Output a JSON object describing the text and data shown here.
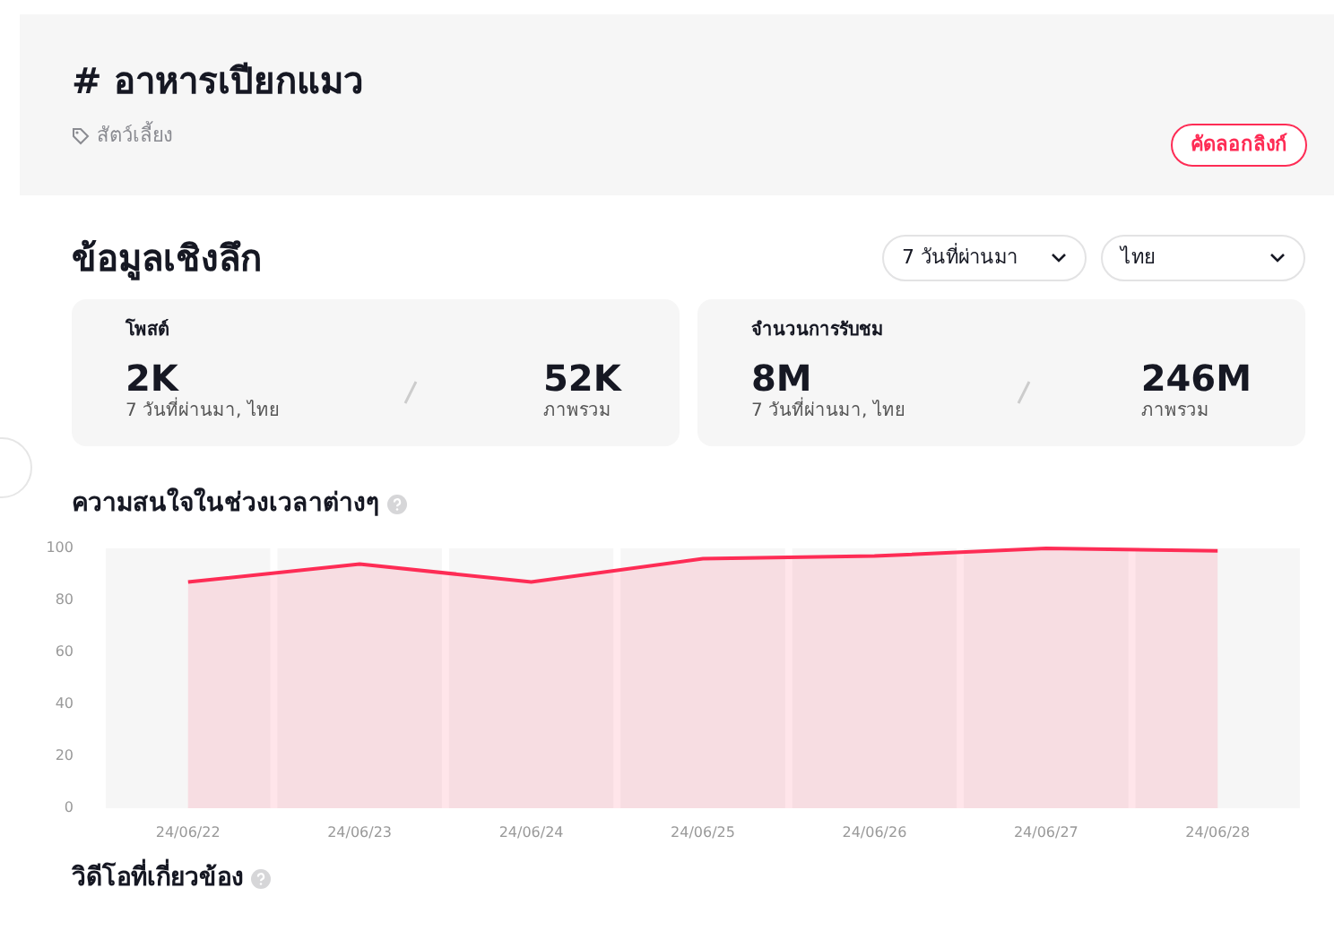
{
  "header": {
    "hashtag": "#",
    "title": "อาหารเปียกแมว",
    "category": "สัตว์เลี้ยง",
    "copy_button": "คัดลอกลิงก์"
  },
  "insights": {
    "title": "ข้อมูลเชิงลึก",
    "filters": [
      {
        "label": "7 วันที่ผ่านมา"
      },
      {
        "label": "ไทย"
      }
    ],
    "stats": [
      {
        "label": "โพสต์",
        "recent_value": "2K",
        "recent_caption": "7 วันที่ผ่านมา, ไทย",
        "total_value": "52K",
        "total_caption": "ภาพรวม"
      },
      {
        "label": "จำนวนการรับชม",
        "recent_value": "8M",
        "recent_caption": "7 วันที่ผ่านมา, ไทย",
        "total_value": "246M",
        "total_caption": "ภาพรวม"
      }
    ]
  },
  "interest": {
    "title": "ความสนใจในช่วงเวลาต่างๆ",
    "chart_data": {
      "type": "line",
      "categories": [
        "24/06/22",
        "24/06/23",
        "24/06/24",
        "24/06/25",
        "24/06/26",
        "24/06/27",
        "24/06/28"
      ],
      "series": [
        {
          "color": "#fe2c55",
          "values": [
            87,
            94,
            87,
            96,
            97,
            100,
            99
          ]
        }
      ],
      "ylim": [
        0,
        100
      ],
      "yticks": [
        0,
        20,
        40,
        60,
        80,
        100
      ]
    }
  },
  "related_videos": {
    "title": "วิดีโอที่เกี่ยวข้อง"
  }
}
